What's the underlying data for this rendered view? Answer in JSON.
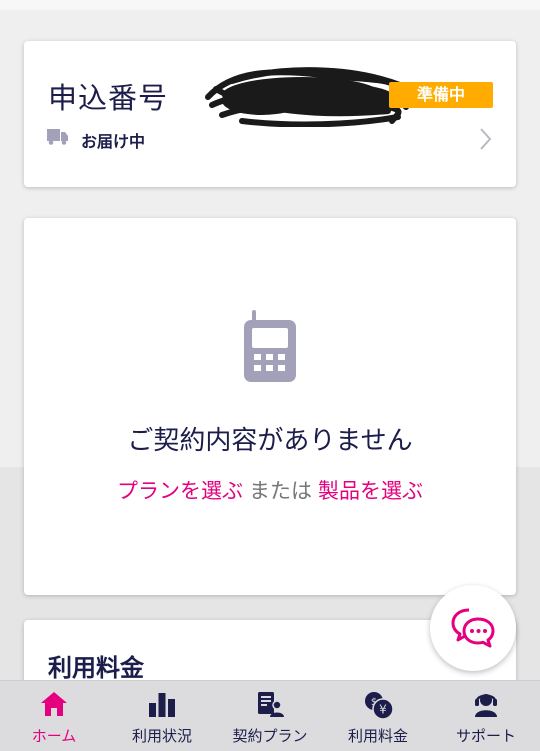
{
  "order": {
    "title": "申込番号",
    "status_badge": "準備中",
    "delivery_status": "お届け中"
  },
  "contract": {
    "empty_message": "ご契約内容がありません",
    "choose_plan": "プランを選ぶ",
    "or": "または",
    "choose_product": "製品を選ぶ"
  },
  "usage": {
    "title": "利用料金"
  },
  "nav": {
    "items": [
      {
        "label": "ホーム",
        "icon": "home-icon",
        "active": true
      },
      {
        "label": "利用状況",
        "icon": "bar-chart-icon"
      },
      {
        "label": "契約プラン",
        "icon": "contract-plan-icon"
      },
      {
        "label": "利用料金",
        "icon": "yen-coins-icon"
      },
      {
        "label": "サポート",
        "icon": "support-agent-icon"
      }
    ]
  },
  "colors": {
    "accent": "#e4007f",
    "navy": "#1c1d4a",
    "badge": "#ffab00",
    "icon_gray": "#a3a1b9"
  }
}
